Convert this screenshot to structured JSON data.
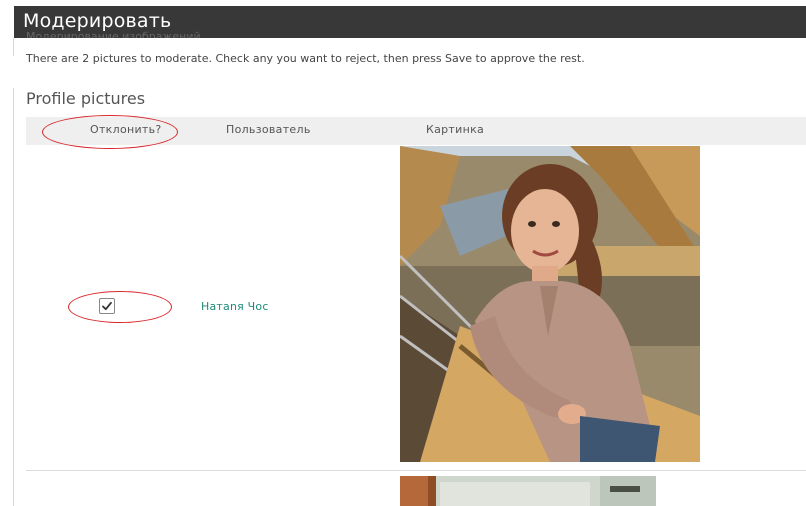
{
  "header": {
    "title": "Модерировать"
  },
  "subtitle_cut": "Модерирование изображений",
  "instruction": "There are 2 pictures to moderate. Check any you want to reject, then press Save to approve the rest.",
  "section": {
    "title": "Profile pictures"
  },
  "table": {
    "columns": [
      "Отклонить?",
      "Пользователь",
      "Картинка"
    ],
    "rows": [
      {
        "reject_checked": true,
        "user": "Натаnя Чос",
        "picture": "profile-photo-woman-in-classroom"
      },
      {
        "reject_checked": false,
        "user": "",
        "picture": "profile-photo-partial"
      }
    ]
  },
  "annotation_color": "#d8262b",
  "link_color": "#1e8a7a"
}
